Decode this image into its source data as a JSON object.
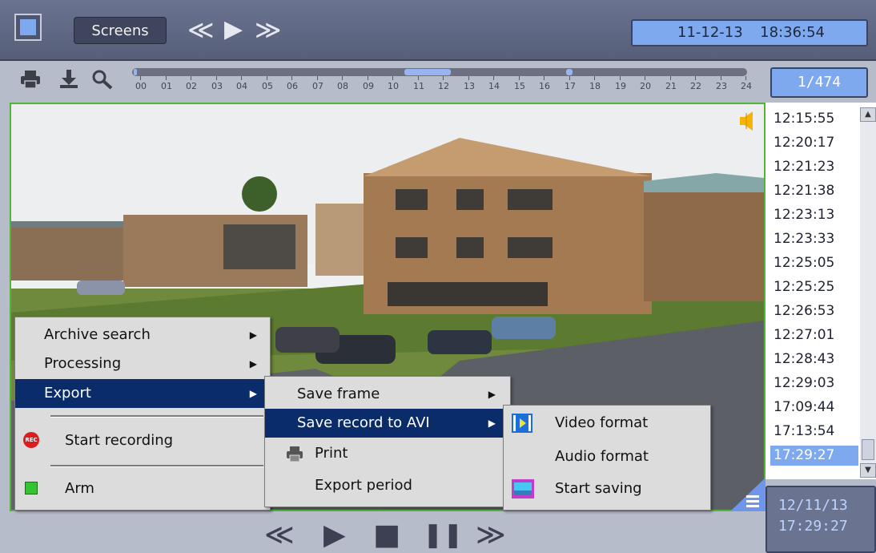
{
  "topbar": {
    "screens_label": "Screens",
    "nav_rewind": "≪",
    "nav_play": "▶",
    "nav_forward": "≫",
    "date": "11-12-13",
    "time": "18:36:54"
  },
  "toolbar": {
    "print_icon": "printer-icon",
    "download_icon": "download-icon",
    "search_icon": "search-icon",
    "hours": [
      "00",
      "01",
      "02",
      "03",
      "04",
      "05",
      "06",
      "07",
      "08",
      "09",
      "10",
      "11",
      "12",
      "13",
      "14",
      "15",
      "16",
      "17",
      "18",
      "19",
      "20",
      "21",
      "22",
      "23",
      "24"
    ]
  },
  "counter": "1/474",
  "time_list": {
    "items": [
      "12:15:55",
      "12:20:17",
      "12:21:23",
      "12:21:38",
      "12:23:13",
      "12:23:33",
      "12:25:05",
      "12:25:25",
      "12:26:53",
      "12:27:01",
      "12:28:43",
      "12:29:03",
      "17:09:44",
      "17:13:54",
      "17:29:27"
    ],
    "selected": "17:29:27"
  },
  "current": {
    "date": "12/11/13",
    "time": "17:29:27"
  },
  "context_menu": {
    "archive_search": "Archive search",
    "processing": "Processing",
    "export": "Export",
    "start_recording": "Start recording",
    "arm": "Arm"
  },
  "export_menu": {
    "save_frame": "Save frame",
    "save_record_avi": "Save record to AVI",
    "print": "Print",
    "export_period": "Export period"
  },
  "avi_menu": {
    "video_format": "Video format",
    "audio_format": "Audio format",
    "start_saving": "Start saving"
  },
  "playback": {
    "rewind": "≪",
    "play": "▶",
    "stop": "■",
    "pause": "❚❚",
    "forward": "≫"
  },
  "colors": {
    "accent": "#7fa9ee",
    "menu_highlight": "#0a2c6b",
    "video_border": "#54b43a"
  }
}
